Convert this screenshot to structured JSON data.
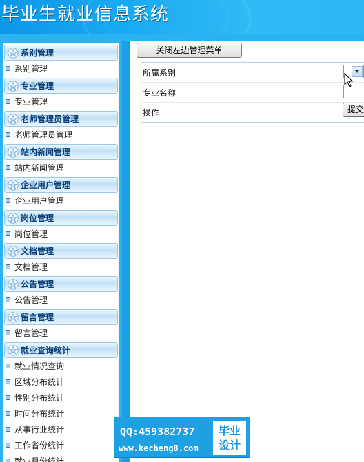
{
  "app": {
    "title": "毕业生就业信息系统"
  },
  "colors": {
    "banner": "#1aaaf2",
    "frame": "#2ab3f3",
    "section_text": "#0b3f78"
  },
  "sidebar": {
    "sections": [
      {
        "title": "系别管理",
        "items": [
          "系别管理"
        ]
      },
      {
        "title": "专业管理",
        "items": [
          "专业管理"
        ]
      },
      {
        "title": "老师管理员管理",
        "items": [
          "老师管理员管理"
        ]
      },
      {
        "title": "站内新闻管理",
        "items": [
          "站内新闻管理"
        ]
      },
      {
        "title": "企业用户管理",
        "items": [
          "企业用户管理"
        ]
      },
      {
        "title": "岗位管理",
        "items": [
          "岗位管理"
        ]
      },
      {
        "title": "文档管理",
        "items": [
          "文档管理"
        ]
      },
      {
        "title": "公告管理",
        "items": [
          "公告管理"
        ]
      },
      {
        "title": "留言管理",
        "items": [
          "留言管理"
        ]
      },
      {
        "title": "就业查询统计",
        "items": [
          "就业情况查询",
          "区域分布统计",
          "性别分布统计",
          "时间分布统计",
          "从事行业统计",
          "工作省份统计",
          "就业月份统计"
        ]
      }
    ],
    "section_icon": "star-icon",
    "item_icon": "bullet-square-icon"
  },
  "toolbar": {
    "close_menu_label": "关闭左边管理菜单"
  },
  "form": {
    "department_label": "所属系别",
    "department_selected": "",
    "major_label": "专业名称",
    "major_value": "",
    "action_label": "操作",
    "submit_label": "提交"
  },
  "watermark": {
    "qq": "QQ:459382737",
    "url": "www.kecheng8.com",
    "badge_line1": "毕业",
    "badge_line2": "设计"
  }
}
